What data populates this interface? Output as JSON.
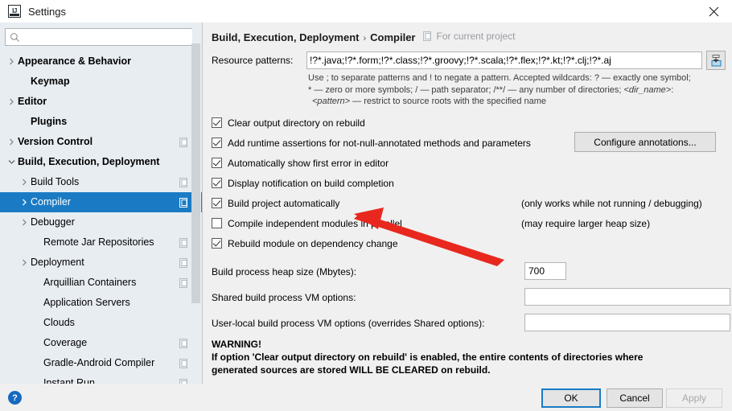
{
  "window": {
    "title": "Settings",
    "logo_icon": "intellij-idea-logo",
    "close_icon": "close-icon"
  },
  "sidebar": {
    "search": {
      "value": "",
      "placeholder": "",
      "icon": "search-icon"
    },
    "items": [
      {
        "label": "Appearance & Behavior",
        "indent": 0,
        "bold": true,
        "arrow": "chevron-right",
        "project_icon": false,
        "selected": false
      },
      {
        "label": "Keymap",
        "indent": 1,
        "bold": true,
        "arrow": "none",
        "project_icon": false,
        "selected": false
      },
      {
        "label": "Editor",
        "indent": 0,
        "bold": true,
        "arrow": "chevron-right",
        "project_icon": false,
        "selected": false
      },
      {
        "label": "Plugins",
        "indent": 1,
        "bold": true,
        "arrow": "none",
        "project_icon": false,
        "selected": false
      },
      {
        "label": "Version Control",
        "indent": 0,
        "bold": true,
        "arrow": "chevron-right",
        "project_icon": true,
        "selected": false
      },
      {
        "label": "Build, Execution, Deployment",
        "indent": 0,
        "bold": true,
        "arrow": "chevron-down",
        "project_icon": false,
        "selected": false
      },
      {
        "label": "Build Tools",
        "indent": 1,
        "bold": false,
        "arrow": "chevron-right",
        "project_icon": true,
        "selected": false
      },
      {
        "label": "Compiler",
        "indent": 1,
        "bold": false,
        "arrow": "chevron-right",
        "project_icon": true,
        "selected": true
      },
      {
        "label": "Debugger",
        "indent": 1,
        "bold": false,
        "arrow": "chevron-right",
        "project_icon": false,
        "selected": false
      },
      {
        "label": "Remote Jar Repositories",
        "indent": 2,
        "bold": false,
        "arrow": "none",
        "project_icon": true,
        "selected": false
      },
      {
        "label": "Deployment",
        "indent": 1,
        "bold": false,
        "arrow": "chevron-right",
        "project_icon": true,
        "selected": false
      },
      {
        "label": "Arquillian Containers",
        "indent": 2,
        "bold": false,
        "arrow": "none",
        "project_icon": true,
        "selected": false
      },
      {
        "label": "Application Servers",
        "indent": 2,
        "bold": false,
        "arrow": "none",
        "project_icon": false,
        "selected": false
      },
      {
        "label": "Clouds",
        "indent": 2,
        "bold": false,
        "arrow": "none",
        "project_icon": false,
        "selected": false
      },
      {
        "label": "Coverage",
        "indent": 2,
        "bold": false,
        "arrow": "none",
        "project_icon": true,
        "selected": false
      },
      {
        "label": "Gradle-Android Compiler",
        "indent": 2,
        "bold": false,
        "arrow": "none",
        "project_icon": true,
        "selected": false
      },
      {
        "label": "Instant Run",
        "indent": 2,
        "bold": false,
        "arrow": "none",
        "project_icon": true,
        "selected": false
      }
    ]
  },
  "content": {
    "breadcrumb": {
      "root": "Build, Execution, Deployment",
      "separator": "›",
      "leaf": "Compiler",
      "scope": "For current project",
      "scope_icon": "project-scope-icon"
    },
    "resource_patterns": {
      "label": "Resource patterns:",
      "value": "!?*.java;!?*.form;!?*.class;!?*.groovy;!?*.scala;!?*.flex;!?*.kt;!?*.clj;!?*.aj",
      "placeholder": "",
      "button_icon": "import-export-icon"
    },
    "help_line1": "Use ; to separate patterns and ! to negate a pattern. Accepted wildcards: ? — exactly one symbol;",
    "help_line2_a": "* — zero or more symbols; / — path separator; /**/ — any number of directories; ",
    "help_line2_b": "<dir_name>",
    "help_line2_c": ":",
    "help_line3_a": "<pattern>",
    "help_line3_b": " — restrict to source roots with the specified name",
    "checkboxes": [
      {
        "label": "Clear output directory on rebuild",
        "checked": true,
        "hint": ""
      },
      {
        "label": "Add runtime assertions for not-null-annotated methods and parameters",
        "checked": true,
        "hint": ""
      },
      {
        "label": "Automatically show first error in editor",
        "checked": true,
        "hint": ""
      },
      {
        "label": "Display notification on build completion",
        "checked": true,
        "hint": ""
      },
      {
        "label": "Build project automatically",
        "checked": true,
        "hint": "(only works while not running / debugging)"
      },
      {
        "label": "Compile independent modules in parallel",
        "checked": false,
        "hint": "(may require larger heap size)"
      },
      {
        "label": "Rebuild module on dependency change",
        "checked": true,
        "hint": ""
      }
    ],
    "configure_annotations_button": "Configure annotations...",
    "fields": [
      {
        "label": "Build process heap size (Mbytes):",
        "value": "700",
        "placeholder": ""
      },
      {
        "label": "Shared build process VM options:",
        "value": "",
        "placeholder": ""
      },
      {
        "label": "User-local build process VM options (overrides Shared options):",
        "value": "",
        "placeholder": ""
      }
    ],
    "warning_title": "WARNING!",
    "warning_line1": "If option 'Clear output directory on rebuild' is enabled, the entire contents of directories where",
    "warning_line2": "generated sources are stored WILL BE CLEARED on rebuild."
  },
  "footer": {
    "help_icon": "help-question-icon",
    "help_label": "?",
    "ok": "OK",
    "cancel": "Cancel",
    "apply": "Apply"
  },
  "annotation": {
    "type": "red-arrow",
    "color": "#e8281e",
    "points_to": "Build project automatically"
  },
  "colors": {
    "accent": "#1a7bc4",
    "sidebar_bg": "#e8edf2",
    "panel_bg": "#f0f0f0",
    "selection": "#1a7bc4",
    "help_blue": "#1769c0"
  }
}
